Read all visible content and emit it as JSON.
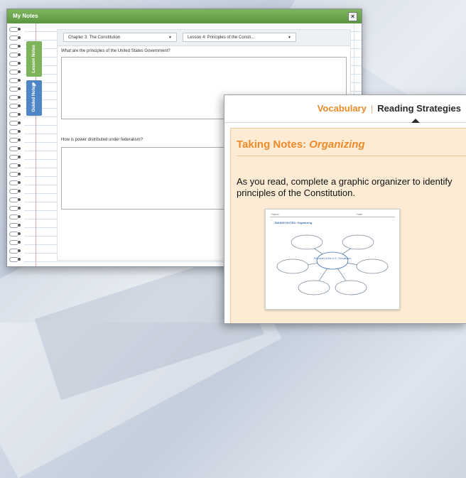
{
  "notes_window": {
    "title": "My Notes",
    "close_glyph": "×",
    "tabs": [
      {
        "label": "Lesson Notes",
        "color": "#7fb35a"
      },
      {
        "label": "Guided Notes",
        "glyph": "✎",
        "color": "#4f86c6"
      }
    ],
    "chapter_select": "Chapter 3: The Constitution",
    "lesson_select": "Lesson 4: Principles of the Consti...",
    "dropdown_glyph": "▼",
    "questions": [
      {
        "text": "What are the principles of the United States Government?",
        "answer": ""
      },
      {
        "text": "How is power distributed under federalism?",
        "answer": ""
      }
    ],
    "accent": "#5b9540"
  },
  "strategy_card": {
    "tab_vocabulary": "Vocabulary",
    "tab_separator": "|",
    "tab_reading": "Reading Strategies",
    "title_prefix": "Taking Notes:",
    "title_emphasis": "Organizing",
    "body_text": "As you read, complete a graphic organizer to identify principles of the Constitution.",
    "accent": "#ee8a2b",
    "thumbnail": {
      "header_name": "Name",
      "header_date": "Date",
      "title": "TAKING NOTES: Organizing",
      "center_label": "Principles of the U.S. Constitution"
    }
  }
}
